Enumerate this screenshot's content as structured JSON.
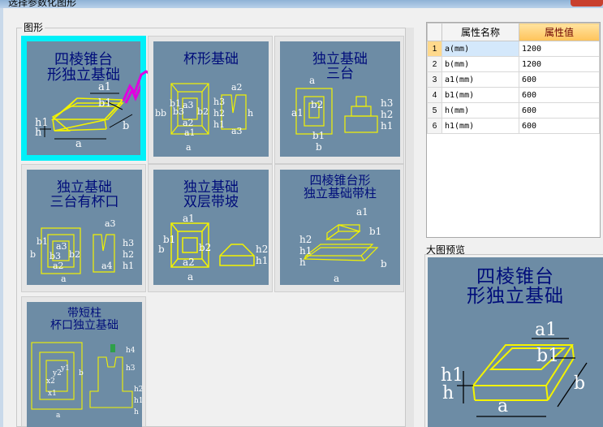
{
  "window": {
    "title": "选择参数化图形"
  },
  "group": {
    "label": "图形"
  },
  "shapes": [
    {
      "title": "四棱锥台\n形独立基础",
      "selected": true
    },
    {
      "title": "杯形基础"
    },
    {
      "title": "独立基础\n三台"
    },
    {
      "title": "独立基础\n三台有杯口"
    },
    {
      "title": "独立基础\n双层带坡"
    },
    {
      "title": "四棱锥台形\n独立基础带柱"
    },
    {
      "title": "带短柱\n杯口独立基础"
    }
  ],
  "labels": {
    "s1": {
      "a1": "a1",
      "b1": "b1",
      "h1": "h1",
      "h": "h",
      "a": "a",
      "b": "b"
    },
    "s2": {
      "bb": "bb",
      "b1": "b1",
      "b3": "b3",
      "b2": "b2",
      "a3": "a3",
      "a2": "a2",
      "a1": "a1",
      "a": "a",
      "h3": "h3",
      "h2": "h2",
      "h1": "h1",
      "h": "h",
      "a2r": "a2",
      "a3r": "a3"
    },
    "s3": {
      "a": "a",
      "a1": "a1",
      "b2": "b2",
      "b1": "b1",
      "b": "b",
      "h3": "h3",
      "h2": "h2",
      "h1": "h1"
    },
    "s4": {
      "b1": "b1",
      "a3": "a3",
      "b3": "b3",
      "b2": "b2",
      "a2": "a2",
      "a": "a",
      "a3r": "a3",
      "a4": "a4",
      "h3": "h3",
      "h2": "h2",
      "h1": "h1",
      "b": "b"
    },
    "s5": {
      "b1": "b1",
      "b": "b",
      "a1": "a1",
      "b2": "b2",
      "a2": "a2",
      "a": "a",
      "h2": "h2",
      "h1": "h1"
    },
    "s6": {
      "a1": "a1",
      "b1": "b1",
      "h2": "h2",
      "h1": "h1",
      "h": "h",
      "a": "a",
      "b": "b"
    },
    "s7": {
      "x1": "x1",
      "x2": "x2",
      "y1": "y1",
      "y2": "y2",
      "b": "b",
      "a": "a",
      "h": "h",
      "h1": "h1",
      "h2": "h2",
      "h3": "h3",
      "h4": "h4"
    }
  },
  "properties": {
    "headers": [
      "",
      "属性名称",
      "属性值"
    ],
    "rows": [
      {
        "num": "1",
        "name": "a(mm)",
        "value": "1200"
      },
      {
        "num": "2",
        "name": "b(mm)",
        "value": "1200"
      },
      {
        "num": "3",
        "name": "a1(mm)",
        "value": "600"
      },
      {
        "num": "4",
        "name": "b1(mm)",
        "value": "600"
      },
      {
        "num": "5",
        "name": "h(mm)",
        "value": "600"
      },
      {
        "num": "6",
        "name": "h1(mm)",
        "value": "600"
      }
    ]
  },
  "preview": {
    "label": "大图预览",
    "title": "四棱锥台\n形独立基础",
    "dims": {
      "a1": "a1",
      "b1": "b1",
      "h1": "h1",
      "h": "h",
      "a": "a",
      "b": "b"
    }
  },
  "colors": {
    "thumb_bg": "#6d8ca5",
    "line": "#f3f300",
    "title": "#000d7a",
    "selection": "#00f0f8",
    "annotation": "#e000e0"
  }
}
